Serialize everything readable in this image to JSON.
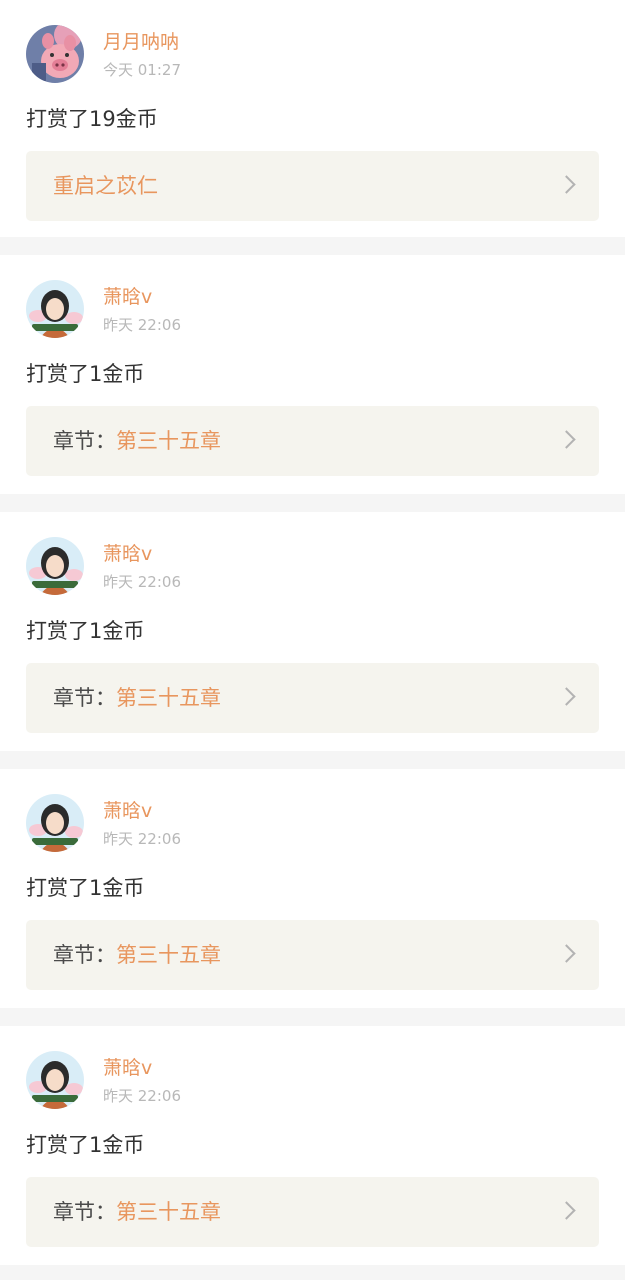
{
  "feed": {
    "items": [
      {
        "user": "月月呐呐",
        "time": "今天 01:27",
        "action": "打赏了19金币",
        "ref_label": "",
        "ref_value": "重启之苡仁",
        "avatar_icon": "pig-cartoon-avatar"
      },
      {
        "user": "萧晗v",
        "time": "昨天 22:06",
        "action": "打赏了1金币",
        "ref_label": "章节：",
        "ref_value": "第三十五章",
        "avatar_icon": "girl-cartoon-avatar"
      },
      {
        "user": "萧晗v",
        "time": "昨天 22:06",
        "action": "打赏了1金币",
        "ref_label": "章节：",
        "ref_value": "第三十五章",
        "avatar_icon": "girl-cartoon-avatar"
      },
      {
        "user": "萧晗v",
        "time": "昨天 22:06",
        "action": "打赏了1金币",
        "ref_label": "章节：",
        "ref_value": "第三十五章",
        "avatar_icon": "girl-cartoon-avatar"
      },
      {
        "user": "萧晗v",
        "time": "昨天 22:06",
        "action": "打赏了1金币",
        "ref_label": "章节：",
        "ref_value": "第三十五章",
        "avatar_icon": "girl-cartoon-avatar"
      }
    ]
  },
  "colors": {
    "accent": "#e8965e",
    "text": "#333333",
    "muted": "#b8b8b8",
    "ref_background": "#f5f4ee",
    "page_background": "#f5f5f5"
  }
}
